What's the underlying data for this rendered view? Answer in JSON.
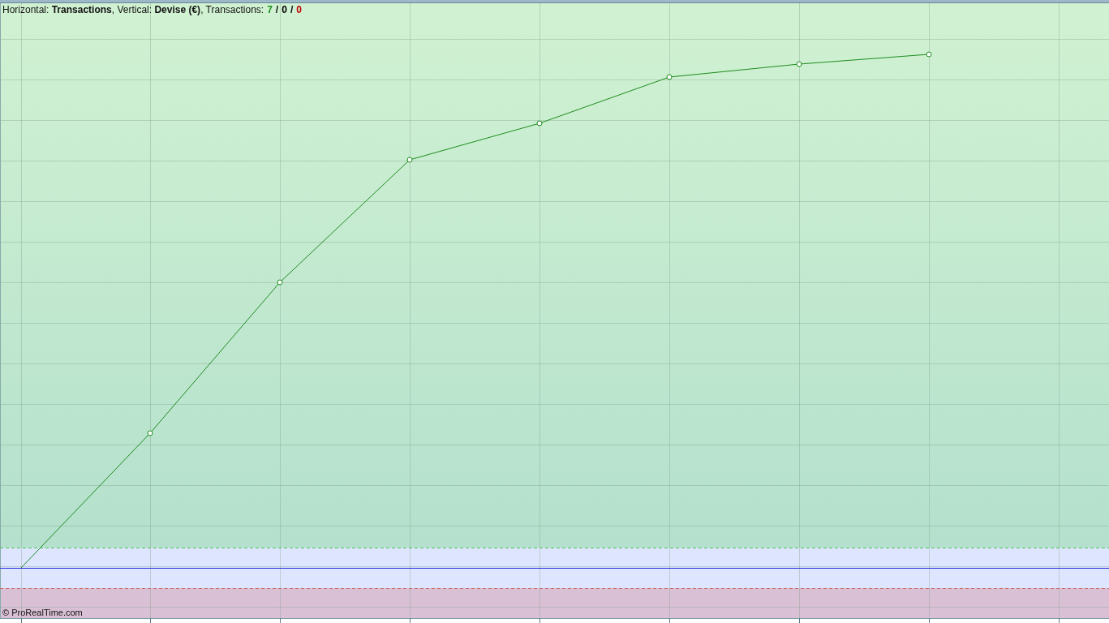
{
  "legend": {
    "text": "Horizontal: **Transactions**, Vertical: **Devise (€)**, Transactions:",
    "separator": "/",
    "counts": [
      {
        "value": "7",
        "color": "#1e8c1e"
      },
      {
        "value": "0",
        "color": "#000000"
      },
      {
        "value": "0",
        "color": "#c00000"
      }
    ]
  },
  "copyright": "© ProRealTime.com"
}
